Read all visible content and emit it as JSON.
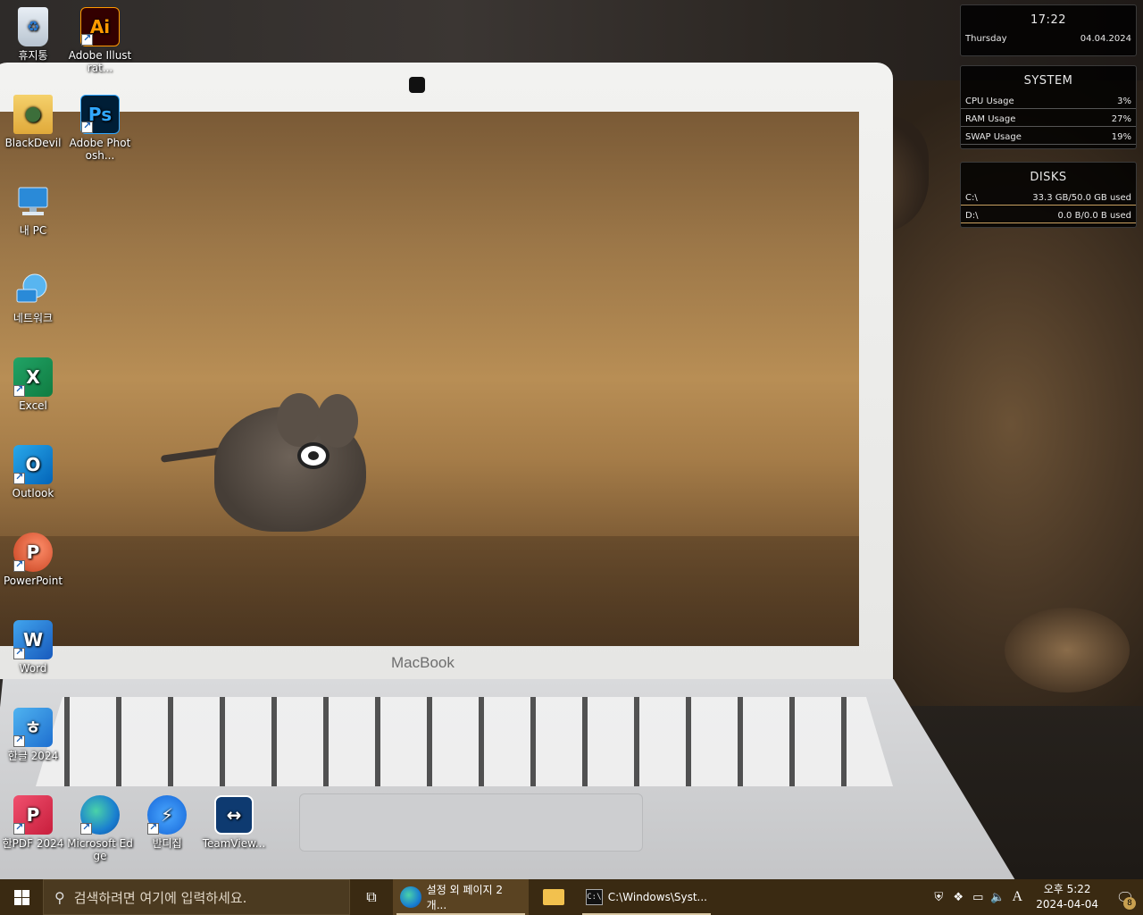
{
  "desktop": {
    "icons": [
      {
        "label": "휴지통",
        "icon": "recycle-bin-icon"
      },
      {
        "label": "Adobe Illustrat...",
        "icon": "illustrator-icon",
        "glyph": "Ai"
      },
      {
        "label": "BlackDevil",
        "icon": "user-folder-icon"
      },
      {
        "label": "Adobe Photosh...",
        "icon": "photoshop-icon",
        "glyph": "Ps"
      },
      {
        "label": "내 PC",
        "icon": "computer-icon"
      },
      {
        "label": "네트워크",
        "icon": "network-icon"
      },
      {
        "label": "Excel",
        "icon": "excel-icon",
        "glyph": "X"
      },
      {
        "label": "Outlook",
        "icon": "outlook-icon",
        "glyph": "O"
      },
      {
        "label": "PowerPoint",
        "icon": "powerpoint-icon",
        "glyph": "P"
      },
      {
        "label": "Word",
        "icon": "word-icon",
        "glyph": "W"
      },
      {
        "label": "한글 2024",
        "icon": "hangul-icon",
        "glyph": "ㅎ"
      },
      {
        "label": "한PDF 2024",
        "icon": "hanpdf-icon",
        "glyph": "P"
      },
      {
        "label": "Microsoft Edge",
        "icon": "edge-icon"
      },
      {
        "label": "반디집",
        "icon": "bandizip-icon",
        "glyph": "⚡"
      },
      {
        "label": "TeamView...",
        "icon": "teamviewer-icon",
        "glyph": "↔"
      }
    ],
    "wallpaper_text": "MacBook"
  },
  "widgets": {
    "clock": {
      "time": "17:22",
      "day": "Thursday",
      "date": "04.04.2024"
    },
    "system": {
      "title": "SYSTEM",
      "rows": [
        {
          "label": "CPU Usage",
          "value": "3%"
        },
        {
          "label": "RAM Usage",
          "value": "27%"
        },
        {
          "label": "SWAP Usage",
          "value": "19%"
        }
      ]
    },
    "disks": {
      "title": "DISKS",
      "rows": [
        {
          "label": "C:\\",
          "value": "33.3 GB/50.0 GB used"
        },
        {
          "label": "D:\\",
          "value": "0.0 B/0.0 B used"
        }
      ]
    }
  },
  "taskbar": {
    "search_placeholder": "검색하려면 여기에 입력하세요.",
    "apps": [
      {
        "label": "설정 외 페이지 2개...",
        "icon": "edge-icon"
      },
      {
        "label": "",
        "icon": "file-explorer-icon"
      },
      {
        "label": "C:\\Windows\\Syst...",
        "icon": "command-prompt-icon"
      }
    ],
    "ime_indicator": "A",
    "clock": {
      "time": "오후 5:22",
      "date": "2024-04-04"
    },
    "notification_count": "8"
  },
  "colors": {
    "taskbar_bg": "#3a2a12",
    "search_bg": "#4b3a20",
    "accent_gold": "#c8a060"
  }
}
